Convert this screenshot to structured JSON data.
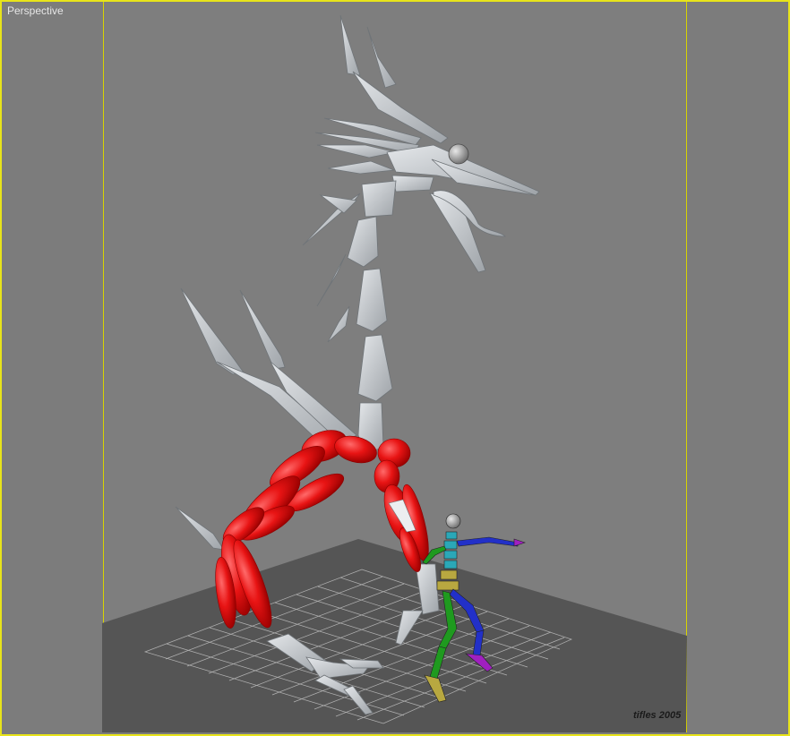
{
  "viewport": {
    "label": "Perspective",
    "credit": "tifles 2005",
    "colors": {
      "border": "#e8e41a",
      "background": "#7c7c7c",
      "ground": "#555555",
      "grid": "#c9c9c9",
      "bones": "#c8ccd0",
      "muscles": "#e01010",
      "biped_spine": "#2aa8b8",
      "biped_left_leg": "#1f9a1f",
      "biped_right_leg": "#2230c8"
    }
  }
}
